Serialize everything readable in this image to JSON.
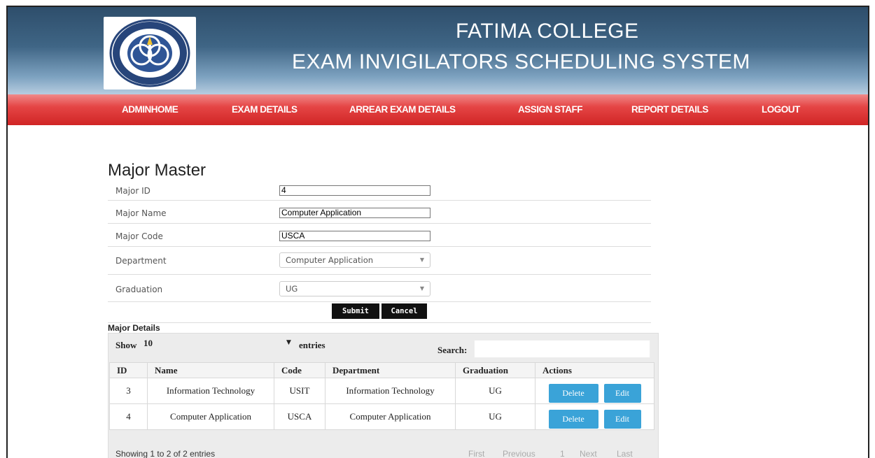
{
  "header": {
    "college_name": "FATIMA COLLEGE",
    "system_name": "EXAM INVIGILATORS SCHEDULING SYSTEM",
    "logo_text_top": "FATIMA COLLEGE",
    "logo_text_bottom": "MADURAI"
  },
  "nav": {
    "items": [
      "ADMINHOME",
      "EXAM DETAILS",
      "ARREAR EXAM DETAILS",
      "ASSIGN STAFF",
      "REPORT DETAILS",
      "LOGOUT"
    ]
  },
  "form": {
    "title": "Major Master",
    "fields": {
      "major_id": {
        "label": "Major ID",
        "value": "4"
      },
      "major_name": {
        "label": "Major Name",
        "value": "Computer Application"
      },
      "major_code": {
        "label": "Major Code",
        "value": "USCA"
      },
      "department": {
        "label": "Department",
        "value": "Computer Application"
      },
      "graduation": {
        "label": "Graduation",
        "value": "UG"
      }
    },
    "submit_label": "Submit",
    "cancel_label": "Cancel"
  },
  "details": {
    "label": "Major Details",
    "show_label": "Show",
    "show_value": "10",
    "entries_label": "entries",
    "search_label": "Search:",
    "columns": [
      "ID",
      "Name",
      "Code",
      "Department",
      "Graduation",
      "Actions"
    ],
    "rows": [
      {
        "id": "3",
        "name": "Information Technology",
        "code": "USIT",
        "department": "Information Technology",
        "graduation": "UG",
        "delete": "Delete",
        "edit": "Edit"
      },
      {
        "id": "4",
        "name": "Computer Application",
        "code": "USCA",
        "department": "Computer Application",
        "graduation": "UG",
        "delete": "Delete",
        "edit": "Edit"
      }
    ],
    "info": "Showing 1 to 2 of 2 entries",
    "pager": {
      "first": "First",
      "previous": "Previous",
      "page": "1",
      "next": "Next",
      "last": "Last"
    }
  },
  "colors": {
    "header_blue": "#3f6585",
    "nav_red": "#e54545",
    "action_blue": "#3aa3d8"
  }
}
